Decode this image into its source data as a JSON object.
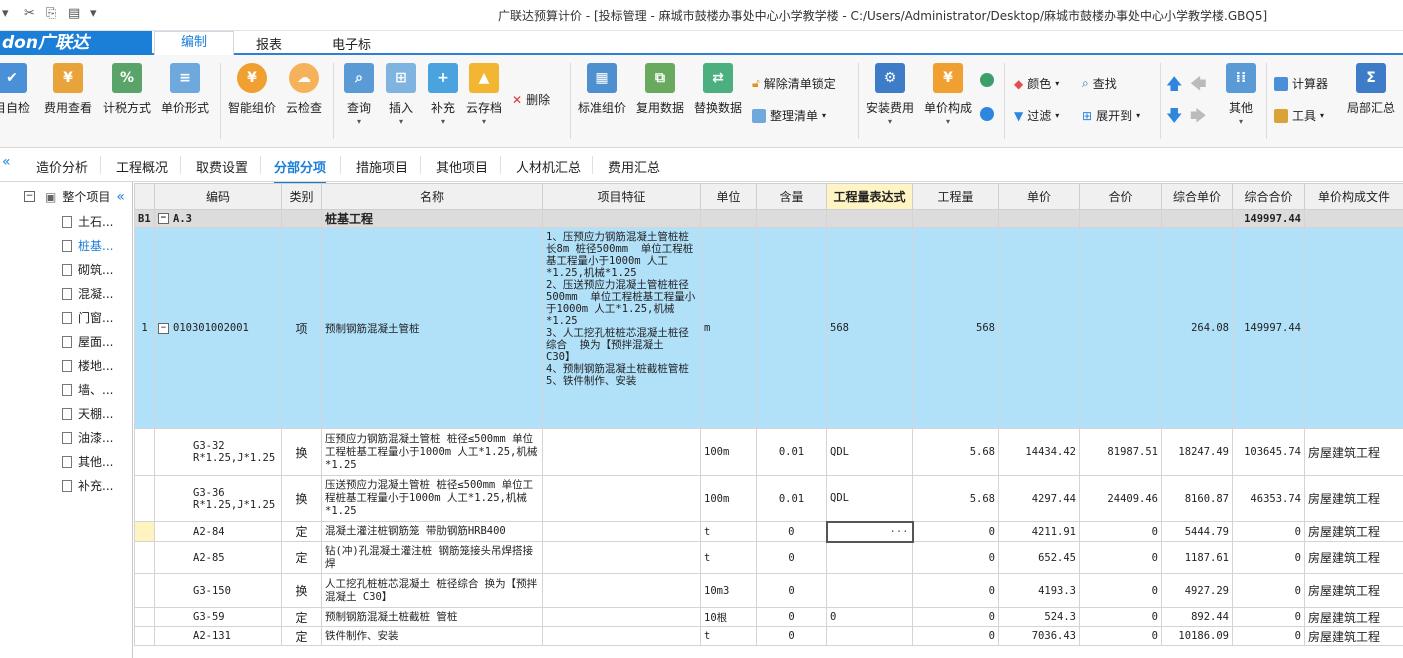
{
  "window": {
    "title": "广联达预算计价 - [投标管理 - 麻城市鼓楼办事处中心小学教学楼 - C:/Users/Administrator/Desktop/麻城市鼓楼办事处中心小学教学楼.GBQ5]"
  },
  "logo": {
    "text": "don广联达"
  },
  "menu": {
    "tabs": [
      "编制",
      "报表",
      "电子标"
    ],
    "active": "编制"
  },
  "ribbon": {
    "buttons": [
      "目自检",
      "费用查看",
      "计税方式",
      "单价形式",
      "智能组价",
      "云检查",
      "查询",
      "插入",
      "补充",
      "云存档",
      "标准组价",
      "复用数据",
      "替换数据",
      "安装费用",
      "单价构成",
      "其他",
      "局部汇总"
    ],
    "small": {
      "delete": "删除",
      "unlock": "解除清单锁定",
      "organize": "整理清单",
      "color": "颜色",
      "find": "查找",
      "filter": "过滤",
      "expand": "展开到",
      "calculator": "计算器",
      "tools": "工具"
    }
  },
  "subtabs": [
    "造价分析",
    "工程概况",
    "取费设置",
    "分部分项",
    "措施项目",
    "其他项目",
    "人材机汇总",
    "费用汇总"
  ],
  "tree": {
    "root": "整个项目",
    "items": [
      "土石...",
      "桩基...",
      "砌筑...",
      "混凝...",
      "门窗...",
      "屋面...",
      "楼地...",
      "墙、...",
      "天棚...",
      "油漆...",
      "其他...",
      "补充..."
    ]
  },
  "table": {
    "headers": [
      "编码",
      "类别",
      "名称",
      "项目特征",
      "单位",
      "含量",
      "工程量表达式",
      "工程量",
      "单价",
      "合价",
      "综合单价",
      "综合合价",
      "单价构成文件"
    ],
    "group": {
      "no": "B1",
      "code": "A.3",
      "name": "桩基工程",
      "total": "149997.44"
    },
    "main": {
      "no": "1",
      "code": "010301002001",
      "type": "项",
      "name": "预制钢筋混凝土管桩",
      "feature": "1、压预应力钢筋混凝土管桩桩长8m 桩径500mm  单位工程桩基工程量小于1000m 人工*1.25,机械*1.25\n2、压送预应力混凝土管桩桩径500mm  单位工程桩基工程量小于1000m 人工*1.25,机械*1.25\n3、人工挖孔桩桩芯混凝土桩径综合  换为【预拌混凝土 C30】\n4、预制钢筋混凝土桩截桩管桩\n5、铁件制作、安装",
      "unit": "m",
      "expr": "568",
      "qty": "568",
      "unit_price": "",
      "total": "",
      "comp_price": "264.08",
      "comp_total": "149997.44",
      "file": ""
    },
    "rows": [
      {
        "code": "G3-32",
        "code2": "R*1.25,J*1.25",
        "type": "换",
        "name": "压预应力钢筋混凝土管桩 桩径≤500mm 单位工程桩基工程量小于1000m 人工*1.25,机械*1.25",
        "unit": "100m",
        "content": "0.01",
        "expr": "QDL",
        "qty": "5.68",
        "price": "14434.42",
        "total": "81987.51",
        "comp_price": "18247.49",
        "comp_total": "103645.74",
        "file": "房屋建筑工程"
      },
      {
        "code": "G3-36",
        "code2": "R*1.25,J*1.25",
        "type": "换",
        "name": "压送预应力混凝土管桩 桩径≤500mm  单位工程桩基工程量小于1000m 人工*1.25,机械*1.25",
        "unit": "100m",
        "content": "0.01",
        "expr": "QDL",
        "qty": "5.68",
        "price": "4297.44",
        "total": "24409.46",
        "comp_price": "8160.87",
        "comp_total": "46353.74",
        "file": "房屋建筑工程"
      },
      {
        "code": "A2-84",
        "code2": "",
        "type": "定",
        "name": "混凝土灌注桩钢筋笼 带肋钢筋HRB400",
        "unit": "t",
        "content": "0",
        "expr": "",
        "qty": "0",
        "price": "4211.91",
        "total": "0",
        "comp_price": "5444.79",
        "comp_total": "0",
        "file": "房屋建筑工程"
      },
      {
        "code": "A2-85",
        "code2": "",
        "type": "定",
        "name": "钻(冲)孔混凝土灌注桩 钢筋笼接头吊焊搭接焊",
        "unit": "t",
        "content": "0",
        "expr": "",
        "qty": "0",
        "price": "652.45",
        "total": "0",
        "comp_price": "1187.61",
        "comp_total": "0",
        "file": "房屋建筑工程"
      },
      {
        "code": "G3-150",
        "code2": "",
        "type": "换",
        "name": "人工挖孔桩桩芯混凝土 桩径综合  换为【预拌混凝土 C30】",
        "unit": "10m3",
        "content": "0",
        "expr": "",
        "qty": "0",
        "price": "4193.3",
        "total": "0",
        "comp_price": "4927.29",
        "comp_total": "0",
        "file": "房屋建筑工程"
      },
      {
        "code": "G3-59",
        "code2": "",
        "type": "定",
        "name": "预制钢筋混凝土桩截桩 管桩",
        "unit": "10根",
        "content": "0",
        "expr": "0",
        "qty": "0",
        "price": "524.3",
        "total": "0",
        "comp_price": "892.44",
        "comp_total": "0",
        "file": "房屋建筑工程"
      },
      {
        "code": "A2-131",
        "code2": "",
        "type": "定",
        "name": "铁件制作、安装",
        "unit": "t",
        "content": "0",
        "expr": "",
        "qty": "0",
        "price": "7036.43",
        "total": "0",
        "comp_price": "10186.09",
        "comp_total": "0",
        "file": "房屋建筑工程"
      }
    ]
  }
}
